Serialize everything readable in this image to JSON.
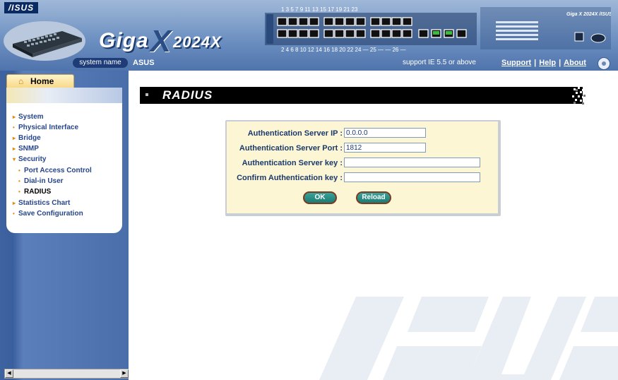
{
  "header": {
    "vendor_logo": "/ISUS",
    "product_name": "Giga",
    "product_x": "X",
    "product_model": "2024X",
    "port_numbers_top": "1   3   5   7     9   11   13   15    17   19   21   23",
    "port_numbers_bottom": "2   4   6   8     10  12   14   16    18   20   22   24    — 25 —  — 26 —",
    "system_name_label": "system name",
    "system_name_value": "ASUS",
    "support_text": "support IE 5.5 or above",
    "links": [
      "Support",
      "Help",
      "About"
    ]
  },
  "sidebar": {
    "home_label": "Home",
    "items": [
      {
        "label": "System",
        "marker": "▸",
        "level": 0
      },
      {
        "label": "Physical Interface",
        "marker": "•",
        "level": 0
      },
      {
        "label": "Bridge",
        "marker": "▸",
        "level": 0
      },
      {
        "label": "SNMP",
        "marker": "▸",
        "level": 0
      },
      {
        "label": "Security",
        "marker": "▾",
        "level": 0
      },
      {
        "label": "Port Access Control",
        "marker": "•",
        "level": 1
      },
      {
        "label": "Dial-in User",
        "marker": "•",
        "level": 1
      },
      {
        "label": "RADIUS",
        "marker": "•",
        "level": 1,
        "active": true
      },
      {
        "label": "Statistics Chart",
        "marker": "▸",
        "level": 0
      },
      {
        "label": "Save Configuration",
        "marker": "•",
        "level": 0
      }
    ]
  },
  "page": {
    "title": "RADIUS"
  },
  "form": {
    "auth_server_ip": {
      "label": "Authentication Server IP :",
      "value": "0.0.0.0"
    },
    "auth_server_port": {
      "label": "Authentication Server Port :",
      "value": "1812"
    },
    "auth_server_key": {
      "label": "Authentication Server key :",
      "value": ""
    },
    "confirm_auth_key": {
      "label": "Confirm Authentication key :",
      "value": ""
    },
    "ok_label": "OK",
    "reload_label": "Reload"
  },
  "colors": {
    "header_blue": "#6e91c2",
    "sidebar_blue": "#4a6ea9",
    "menu_text": "#26458a",
    "form_bg": "#fdf6d5",
    "button_teal": "#2a8f86",
    "title_bar": "#000000"
  }
}
